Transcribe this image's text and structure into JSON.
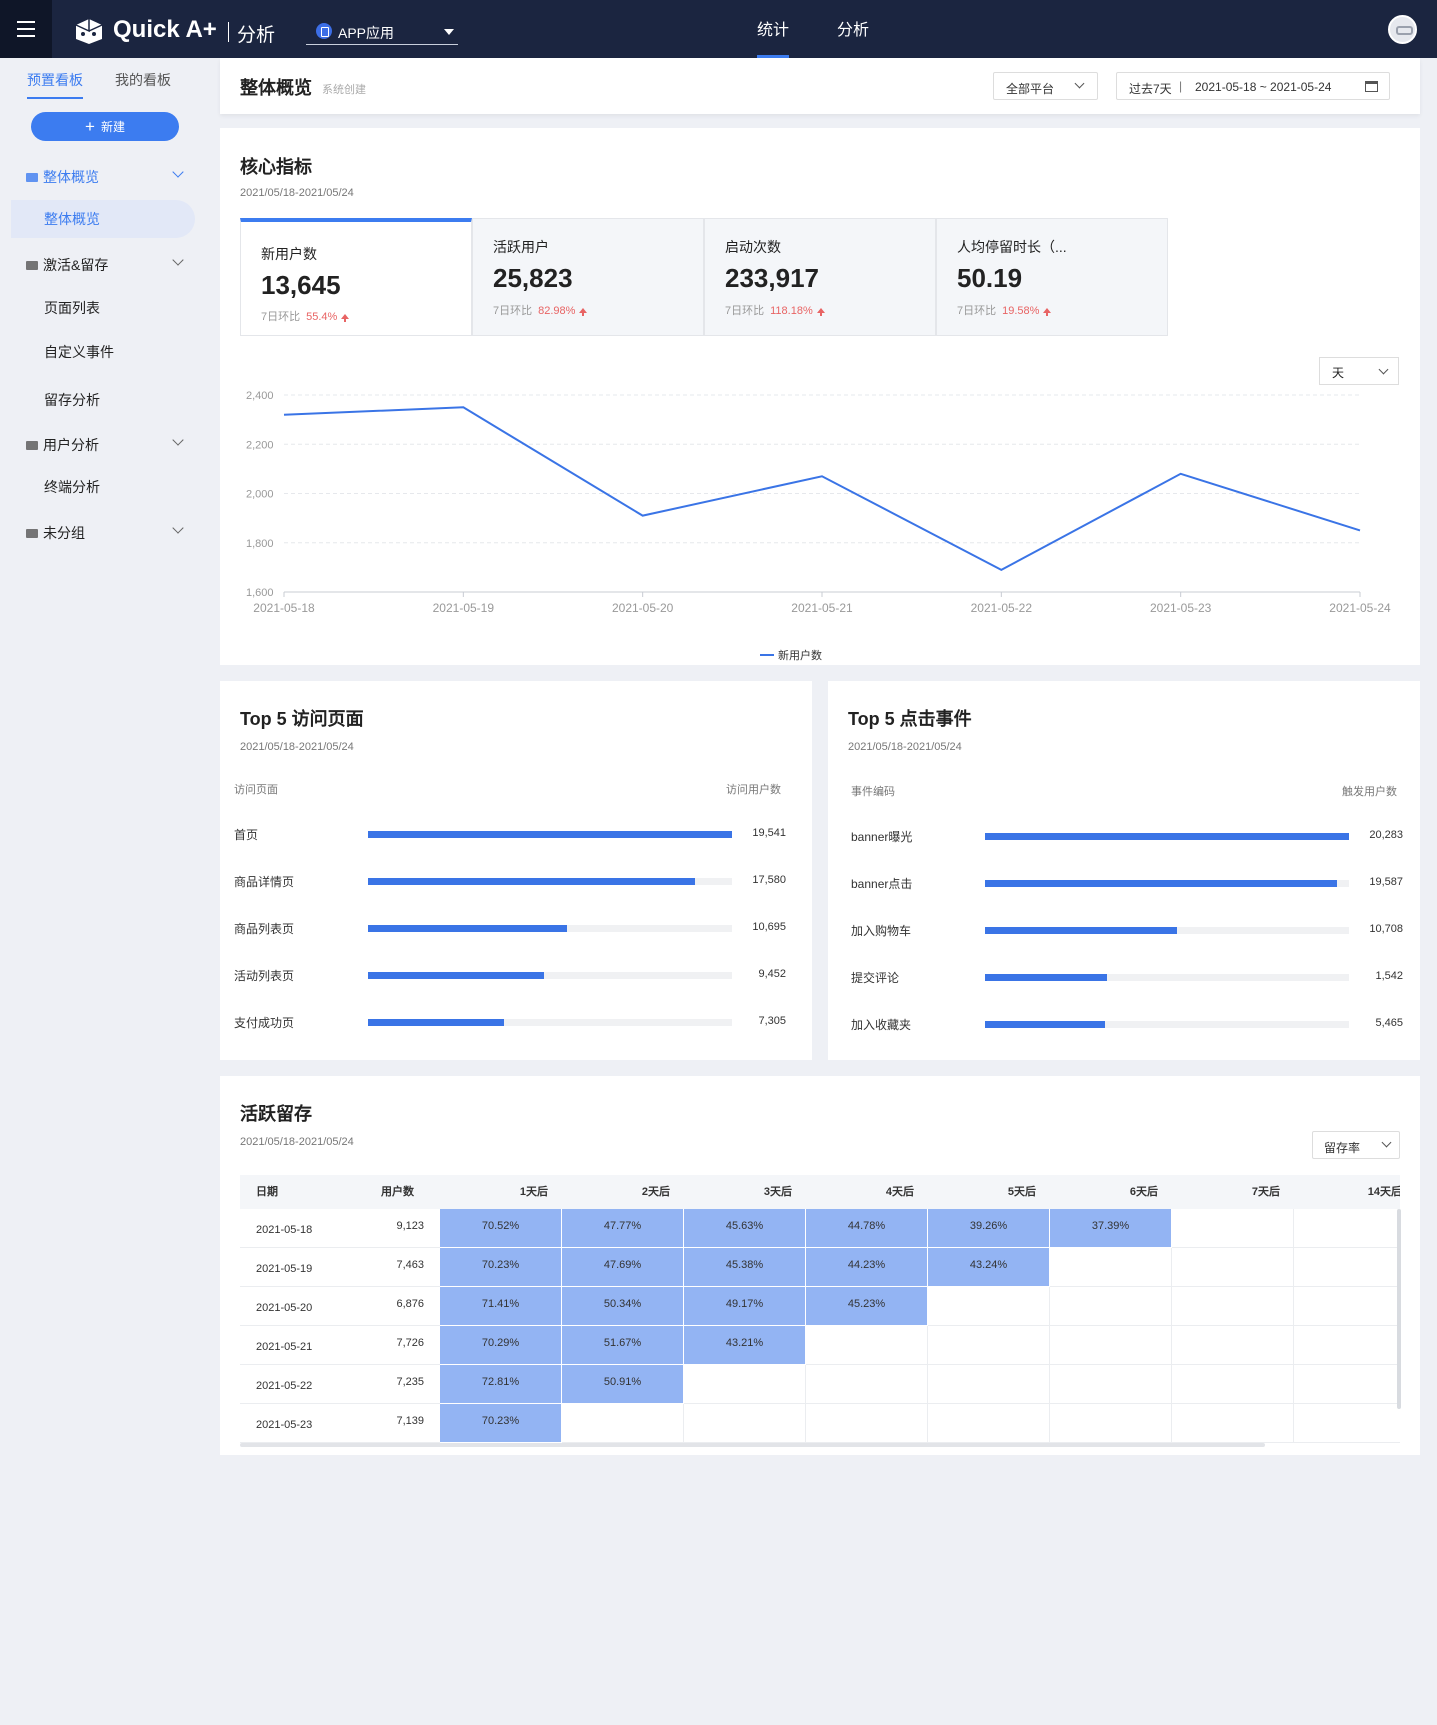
{
  "topbar": {
    "brand": "Quick A+",
    "brand_sub": "分析",
    "app_select": "APP应用",
    "nav": [
      "统计",
      "分析"
    ]
  },
  "sidebar": {
    "tabs": [
      "预置看板",
      "我的看板"
    ],
    "new_label": "新建",
    "groups": [
      {
        "label": "整体概览",
        "items": [
          "整体概览"
        ]
      },
      {
        "label": "激活&留存",
        "items": [
          "页面列表",
          "自定义事件",
          "留存分析"
        ]
      },
      {
        "label": "用户分析",
        "items": [
          "终端分析"
        ]
      },
      {
        "label": "未分组",
        "items": []
      }
    ]
  },
  "header": {
    "title": "整体概览",
    "sub": "系统创建",
    "platform": "全部平台",
    "range_label": "过去7天",
    "range_sep": "|",
    "range_value": "2021-05-18 ~ 2021-05-24"
  },
  "core": {
    "title": "核心指标",
    "date": "2021/05/18-2021/05/24",
    "granularity": "天",
    "kpis": [
      {
        "label": "新用户数",
        "value": "13,645",
        "cmp": "7日环比",
        "pct": "55.4%"
      },
      {
        "label": "活跃用户",
        "value": "25,823",
        "cmp": "7日环比",
        "pct": "82.98%"
      },
      {
        "label": "启动次数",
        "value": "233,917",
        "cmp": "7日环比",
        "pct": "118.18%"
      },
      {
        "label": "人均停留时长（...",
        "value": "50.19",
        "cmp": "7日环比",
        "pct": "19.58%"
      }
    ]
  },
  "chart_data": {
    "type": "line",
    "x": [
      "2021-05-18",
      "2021-05-19",
      "2021-05-20",
      "2021-05-21",
      "2021-05-22",
      "2021-05-23",
      "2021-05-24"
    ],
    "series": [
      {
        "name": "新用户数",
        "values": [
          2320,
          2350,
          1910,
          2070,
          1690,
          2080,
          1850
        ]
      }
    ],
    "yticks": [
      "2,400",
      "2,200",
      "2,000",
      "1,800",
      "1,600"
    ],
    "ylim": [
      1600,
      2400
    ],
    "grid": true,
    "legend": "bottom-center",
    "color": "#3a74e6"
  },
  "top_pages": {
    "title": "Top 5 访问页面",
    "date": "2021/05/18-2021/05/24",
    "col1": "访问页面",
    "col2": "访问用户数",
    "max": 19541,
    "rows": [
      {
        "label": "首页",
        "value": 19541,
        "text": "19,541"
      },
      {
        "label": "商品详情页",
        "value": 17580,
        "text": "17,580"
      },
      {
        "label": "商品列表页",
        "value": 10695,
        "text": "10,695"
      },
      {
        "label": "活动列表页",
        "value": 9452,
        "text": "9,452"
      },
      {
        "label": "支付成功页",
        "value": 7305,
        "text": "7,305"
      }
    ]
  },
  "top_events": {
    "title": "Top 5 点击事件",
    "date": "2021/05/18-2021/05/24",
    "col1": "事件编码",
    "col2": "触发用户数",
    "rows": [
      {
        "label": "banner曝光",
        "value": 20283,
        "text": "20,283"
      },
      {
        "label": "banner点击",
        "value": 19587,
        "text": "19,587"
      },
      {
        "label": "加入购物车",
        "value": 10708,
        "text": "10,708"
      },
      {
        "label": "提交评论",
        "value": 6800,
        "text": "1,542"
      },
      {
        "label": "加入收藏夹",
        "value": 6700,
        "text": "5,465"
      }
    ]
  },
  "retention": {
    "title": "活跃留存",
    "date": "2021/05/18-2021/05/24",
    "mode": "留存率",
    "headers": [
      "日期",
      "用户数",
      "1天后",
      "2天后",
      "3天后",
      "4天后",
      "5天后",
      "6天后",
      "7天后",
      "14天后"
    ],
    "rows": [
      {
        "date": "2021-05-18",
        "users": "9,123",
        "rates": [
          "70.52%",
          "47.77%",
          "45.63%",
          "44.78%",
          "39.26%",
          "37.39%"
        ]
      },
      {
        "date": "2021-05-19",
        "users": "7,463",
        "rates": [
          "70.23%",
          "47.69%",
          "45.38%",
          "44.23%",
          "43.24%"
        ]
      },
      {
        "date": "2021-05-20",
        "users": "6,876",
        "rates": [
          "71.41%",
          "50.34%",
          "49.17%",
          "45.23%"
        ]
      },
      {
        "date": "2021-05-21",
        "users": "7,726",
        "rates": [
          "70.29%",
          "51.67%",
          "43.21%"
        ]
      },
      {
        "date": "2021-05-22",
        "users": "7,235",
        "rates": [
          "72.81%",
          "50.91%"
        ]
      },
      {
        "date": "2021-05-23",
        "users": "7,139",
        "rates": [
          "70.23%"
        ]
      }
    ]
  }
}
